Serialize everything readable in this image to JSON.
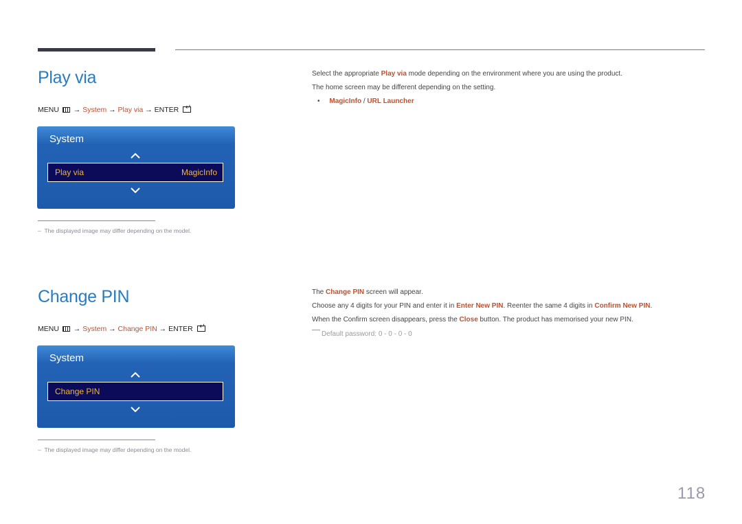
{
  "colors": {
    "heading": "#2a7cc2",
    "highlight": "#c1502d",
    "osd_bg": "#1e5aac",
    "osd_selected_bg": "#0b0b5a",
    "osd_selected_text": "#f0b63a"
  },
  "sections": [
    {
      "title": "Play via",
      "menu_path": {
        "menu": "MENU",
        "menu_icon": "menu-grid-icon",
        "arrow": "→",
        "system": "System",
        "item": "Play via",
        "enter": "ENTER",
        "enter_icon": "enter-icon"
      },
      "osd": {
        "title": "System",
        "up_icon": "chevron-up-icon",
        "down_icon": "chevron-down-icon",
        "row_label": "Play via",
        "row_value": "MagicInfo"
      },
      "footnote": "The displayed image may differ depending on the model.",
      "description": {
        "line1_pre": "Select the appropriate ",
        "line1_hl": "Play via",
        "line1_post": " mode depending on the environment where you are using the product.",
        "line2": "The home screen may be different depending on the setting.",
        "bullet_a": "MagicInfo",
        "bullet_sep": " / ",
        "bullet_b": "URL Launcher"
      }
    },
    {
      "title": "Change PIN",
      "menu_path": {
        "menu": "MENU",
        "menu_icon": "menu-grid-icon",
        "arrow": "→",
        "system": "System",
        "item": "Change PIN",
        "enter": "ENTER",
        "enter_icon": "enter-icon"
      },
      "osd": {
        "title": "System",
        "up_icon": "chevron-up-icon",
        "down_icon": "chevron-down-icon",
        "row_label": "Change PIN",
        "row_value": ""
      },
      "footnote": "The displayed image may differ depending on the model.",
      "description": {
        "line1_pre": "The ",
        "line1_hl": "Change PIN",
        "line1_post": " screen will appear.",
        "line2_pre": "Choose any 4 digits for your PIN and enter it in ",
        "line2_hl1": "Enter New PIN",
        "line2_mid": ". Reenter the same 4 digits in ",
        "line2_hl2": "Confirm New PIN",
        "line2_post": ".",
        "line3_pre": "When the Confirm screen disappears, press the ",
        "line3_hl": "Close",
        "line3_post": " button. The product has memorised your new PIN.",
        "note": "Default password: 0 - 0 - 0 - 0"
      }
    }
  ],
  "page_number": "118"
}
